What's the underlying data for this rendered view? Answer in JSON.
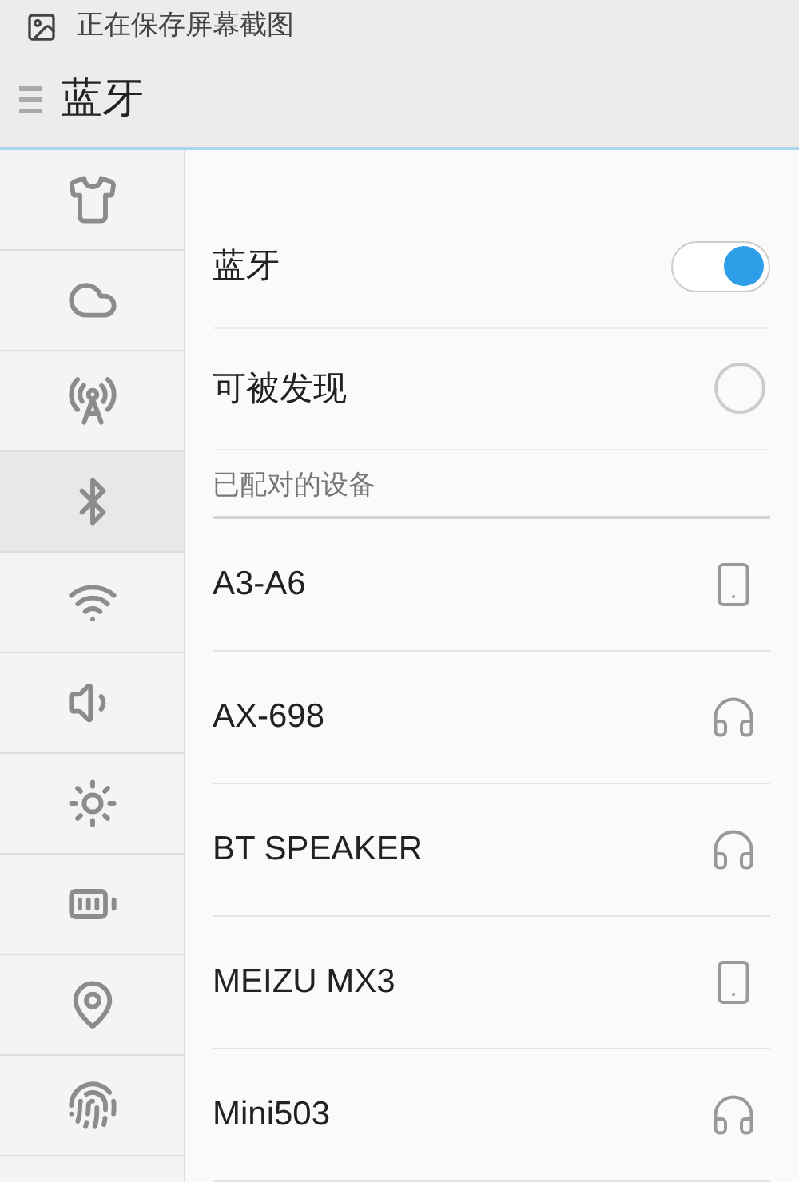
{
  "status_bar": {
    "text": "正在保存屏幕截图"
  },
  "title_bar": {
    "title": "蓝牙"
  },
  "sidebar": {
    "items": [
      {
        "kind": "shirt",
        "selected": false
      },
      {
        "kind": "cloud",
        "selected": false
      },
      {
        "kind": "hotspot",
        "selected": false
      },
      {
        "kind": "bluetooth",
        "selected": true
      },
      {
        "kind": "wifi",
        "selected": false
      },
      {
        "kind": "sound",
        "selected": false
      },
      {
        "kind": "brightness",
        "selected": false
      },
      {
        "kind": "battery",
        "selected": false
      },
      {
        "kind": "location",
        "selected": false
      },
      {
        "kind": "fingerprint",
        "selected": false
      }
    ]
  },
  "settings": [
    {
      "label": "蓝牙",
      "kind": "switch",
      "on": true
    },
    {
      "label": "可被发现",
      "kind": "radio",
      "on": false
    }
  ],
  "paired_section": {
    "title": "已配对的设备"
  },
  "devices": [
    {
      "name": "A3-A6",
      "kind": "phone"
    },
    {
      "name": "AX-698",
      "kind": "headphones"
    },
    {
      "name": "BT SPEAKER",
      "kind": "headphones"
    },
    {
      "name": "MEIZU MX3",
      "kind": "phone"
    },
    {
      "name": "Mini503",
      "kind": "headphones"
    }
  ]
}
